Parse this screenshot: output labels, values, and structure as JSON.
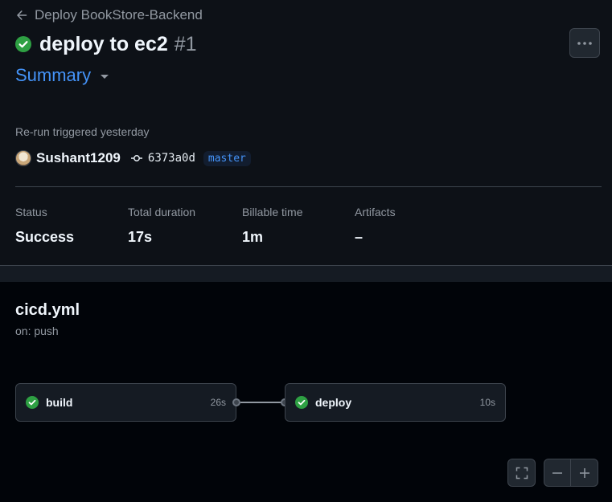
{
  "header": {
    "back_label": "Deploy BookStore-Backend",
    "title": "deploy to ec2",
    "run_number": "#1",
    "summary_label": "Summary",
    "more_label": "···"
  },
  "run": {
    "trigger_text": "Re-run triggered yesterday",
    "actor": "Sushant1209",
    "commit_sha": "6373a0d",
    "branch": "master"
  },
  "stats": [
    {
      "label": "Status",
      "value": "Success"
    },
    {
      "label": "Total duration",
      "value": "17s"
    },
    {
      "label": "Billable time",
      "value": "1m"
    },
    {
      "label": "Artifacts",
      "value": "–"
    }
  ],
  "workflow": {
    "file": "cicd.yml",
    "trigger": "on: push",
    "jobs": [
      {
        "name": "build",
        "duration": "26s",
        "status": "success"
      },
      {
        "name": "deploy",
        "duration": "10s",
        "status": "success"
      }
    ]
  },
  "icons": {
    "back": "arrow-left-icon",
    "status": "check-circle-fill-icon",
    "commit": "git-commit-icon",
    "fullscreen": "screen-full-icon",
    "zoom_out": "dash-icon",
    "zoom_in": "plus-icon"
  },
  "colors": {
    "success": "#2ea043",
    "link": "#4493f8",
    "page_bg": "#010409",
    "panel_bg": "#0d1117"
  }
}
